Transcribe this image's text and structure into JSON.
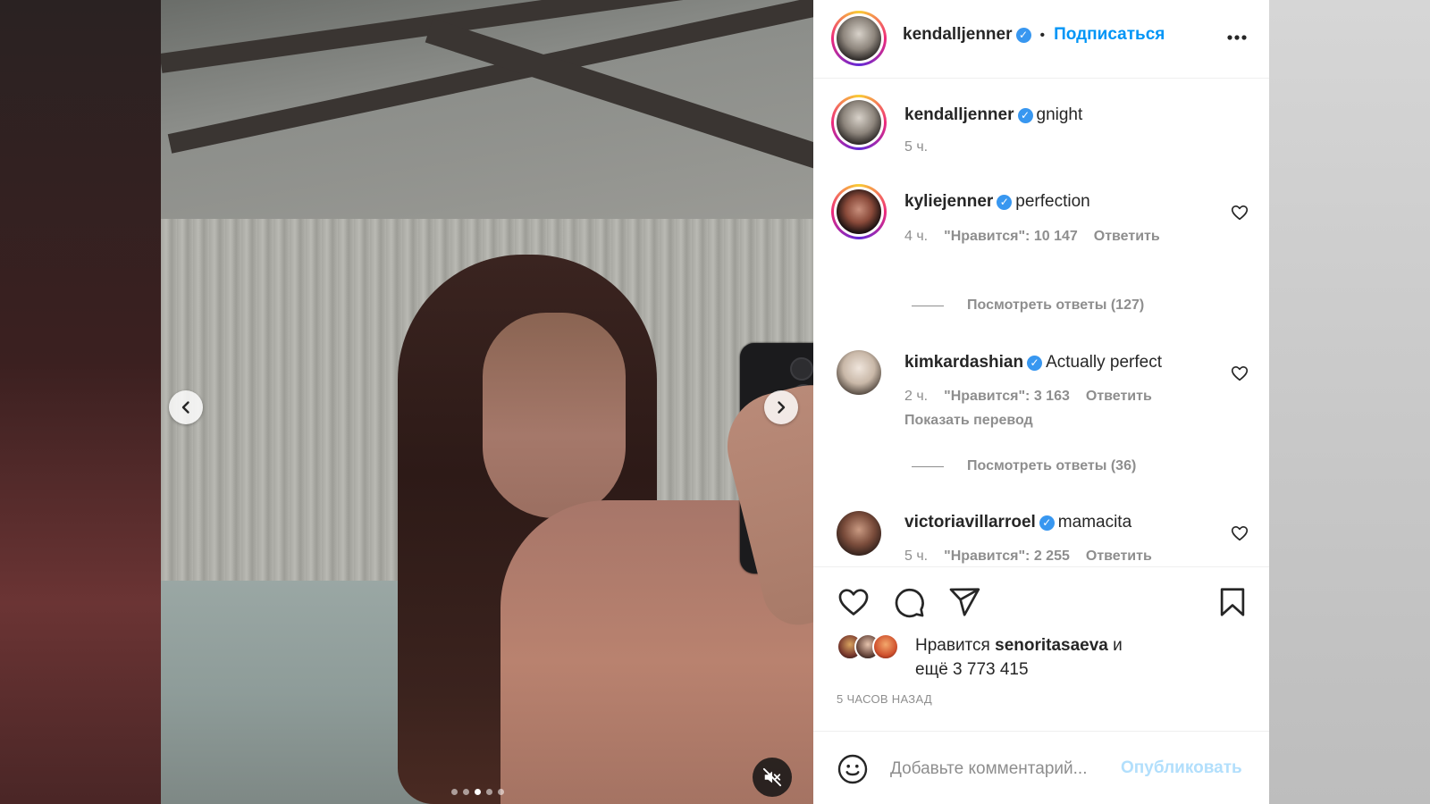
{
  "colors": {
    "accent": "#0095f6",
    "verified": "#3897f0",
    "text": "#262626",
    "muted": "#8e8e8e",
    "publish_disabled": "#b2dffc"
  },
  "media": {
    "carousel": {
      "count": 5,
      "active_index": 2
    },
    "prev_icon": "chevron-left-icon",
    "next_icon": "chevron-right-icon",
    "mute_icon": "speaker-muted-icon"
  },
  "header": {
    "username": "kendalljenner",
    "verified": true,
    "follow_label": "Подписаться",
    "more_icon": "more-horizontal-icon"
  },
  "caption": {
    "username": "kendalljenner",
    "text": "gnight",
    "time": "5 ч."
  },
  "comments": [
    {
      "username": "kyliejenner",
      "text": "perfection",
      "time": "4 ч.",
      "likes": "\"Нравится\": 10 147",
      "reply_label": "Ответить",
      "view_replies": "Посмотреть ответы (127)"
    },
    {
      "username": "kimkardashian",
      "text": "Actually perfect",
      "time": "2 ч.",
      "likes": "\"Нравится\": 3 163",
      "reply_label": "Ответить",
      "translate_label": "Показать перевод",
      "view_replies": "Посмотреть ответы (36)"
    },
    {
      "username": "victoriavillarroel",
      "text": "mamacita",
      "time": "5 ч.",
      "likes": "\"Нравится\": 2 255",
      "reply_label": "Ответить"
    }
  ],
  "actions": {
    "like_icon": "heart-icon",
    "comment_icon": "comment-bubble-icon",
    "share_icon": "paper-plane-icon",
    "save_icon": "bookmark-icon"
  },
  "likes": {
    "prefix": "Нравится",
    "user": "senoritasaeva",
    "and": "и",
    "more": "ещё 3 773 415"
  },
  "timestamp": "5 ЧАСОВ НАЗАД",
  "comment_box": {
    "emoji_icon": "smiley-icon",
    "placeholder": "Добавьте комментарий...",
    "publish_label": "Опубликовать"
  }
}
